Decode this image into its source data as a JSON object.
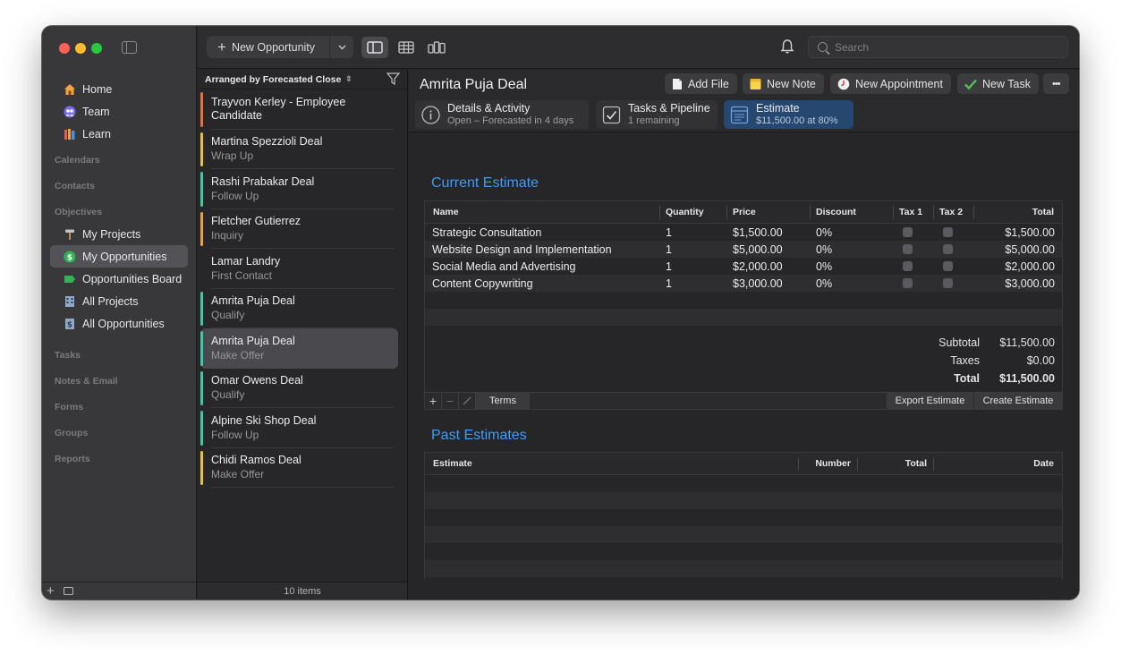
{
  "sidebar": {
    "nav": [
      {
        "label": "Home",
        "icon": "home-icon",
        "color": "#f4a340"
      },
      {
        "label": "Team",
        "icon": "team-icon",
        "color": "#7c6cf2"
      },
      {
        "label": "Learn",
        "icon": "books-icon",
        "color": "#e6a23c"
      }
    ],
    "sections": {
      "calendars": "Calendars",
      "contacts": "Contacts",
      "objectives": "Objectives",
      "tasks": "Tasks",
      "notes_email": "Notes & Email",
      "forms": "Forms",
      "groups": "Groups",
      "reports": "Reports"
    },
    "objectives": [
      {
        "label": "My Projects",
        "icon": "hammer-icon",
        "color": "#c2c2c6",
        "selected": false
      },
      {
        "label": "My Opportunities",
        "icon": "dollar-icon",
        "color": "#32b456",
        "selected": true
      },
      {
        "label": "Opportunities Board",
        "icon": "tag-icon",
        "color": "#32b456",
        "selected": false
      },
      {
        "label": "All Projects",
        "icon": "building-icon",
        "color": "#8fa8c8",
        "selected": false
      },
      {
        "label": "All Opportunities",
        "icon": "building-dollar-icon",
        "color": "#8fa8c8",
        "selected": false
      }
    ],
    "bottom_add": "+"
  },
  "toolbar": {
    "new_opportunity": "New Opportunity",
    "search_placeholder": "Search"
  },
  "list": {
    "sort_label": "Arranged by Forecasted Close",
    "footer": "10 items",
    "items": [
      {
        "title": "Trayvon Kerley - Employee Candidate",
        "sub": "",
        "color": "#e8703a"
      },
      {
        "title": "Martina Spezzioli Deal",
        "sub": "Wrap Up",
        "color": "#e8c23a"
      },
      {
        "title": "Rashi Prabakar Deal",
        "sub": "Follow Up",
        "color": "#3ec9a7"
      },
      {
        "title": "Fletcher Gutierrez",
        "sub": "Inquiry",
        "color": "#e8a33a"
      },
      {
        "title": "Lamar Landry",
        "sub": "First Contact",
        "color": ""
      },
      {
        "title": "Amrita Puja Deal",
        "sub": "Qualify",
        "color": "#3ec9a7"
      },
      {
        "title": "Amrita Puja Deal",
        "sub": "Make Offer",
        "color": "#3ec9a7",
        "selected": true
      },
      {
        "title": "Omar Owens Deal",
        "sub": "Qualify",
        "color": "#3ec9a7"
      },
      {
        "title": "Alpine Ski Shop Deal",
        "sub": "Follow Up",
        "color": "#3ec9a7"
      },
      {
        "title": "Chidi Ramos Deal",
        "sub": "Make Offer",
        "color": "#e8c23a"
      }
    ]
  },
  "detail": {
    "title": "Amrita Puja Deal",
    "actions": {
      "add_file": "Add File",
      "new_note": "New Note",
      "new_appointment": "New Appointment",
      "new_task": "New Task",
      "more": "•••"
    },
    "tabs": [
      {
        "title": "Details & Activity",
        "sub": "Open – Forecasted in 4 days"
      },
      {
        "title": "Tasks & Pipeline",
        "sub": "1 remaining"
      },
      {
        "title": "Estimate",
        "sub": "$11,500.00 at 80%"
      }
    ],
    "current_estimate": {
      "heading": "Current Estimate",
      "columns": [
        "Name",
        "Quantity",
        "Price",
        "Discount",
        "Tax 1",
        "Tax 2",
        "Total"
      ],
      "rows": [
        {
          "name": "Strategic Consultation",
          "qty": "1",
          "price": "$1,500.00",
          "discount": "0%",
          "total": "$1,500.00"
        },
        {
          "name": "Website Design and Implementation",
          "qty": "1",
          "price": "$5,000.00",
          "discount": "0%",
          "total": "$5,000.00"
        },
        {
          "name": "Social Media and Advertising",
          "qty": "1",
          "price": "$2,000.00",
          "discount": "0%",
          "total": "$2,000.00"
        },
        {
          "name": "Content Copywriting",
          "qty": "1",
          "price": "$3,000.00",
          "discount": "0%",
          "total": "$3,000.00"
        }
      ],
      "subtotal_label": "Subtotal",
      "subtotal": "$11,500.00",
      "taxes_label": "Taxes",
      "taxes": "$0.00",
      "total_label": "Total",
      "total": "$11,500.00",
      "footer": {
        "terms": "Terms",
        "export": "Export Estimate",
        "create": "Create Estimate"
      }
    },
    "past_estimates": {
      "heading": "Past Estimates",
      "columns": [
        "Estimate",
        "Number",
        "Total",
        "Date"
      ]
    }
  }
}
